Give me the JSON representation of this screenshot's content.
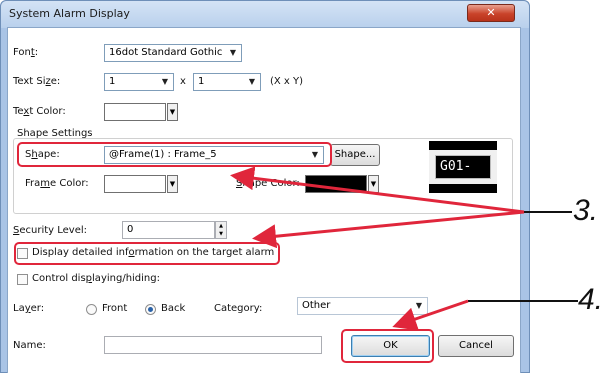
{
  "dialog": {
    "title": "System Alarm Display",
    "close_glyph": "✕"
  },
  "font": {
    "label_pre": "Fon",
    "label_u": "t",
    "label_post": ":",
    "value": "16dot Standard Gothic"
  },
  "text_size": {
    "label_pre": "Text Si",
    "label_u": "z",
    "label_post": "e:",
    "x_value": "1",
    "y_value": "1",
    "times": "x",
    "unit": "(X x Y)"
  },
  "text_color": {
    "label_pre": "Te",
    "label_u": "x",
    "label_post": "t Color:",
    "value": "#ffffff"
  },
  "shape_settings": {
    "group_label": "Shape Settings",
    "shape_label_pre": "S",
    "shape_label_u": "h",
    "shape_label_post": "ape:",
    "shape_value": "@Frame(1) : Frame_5",
    "shape_button": "Shape...",
    "frame_color_label_pre": "Fra",
    "frame_color_label_u": "m",
    "frame_color_label_post": "e Color:",
    "frame_color": "#ffffff",
    "shape_color_label_pre": "",
    "shape_color_label_u": "S",
    "shape_color_label_post": "hape Color:",
    "shape_color": "#000000",
    "preview_text": "G01-"
  },
  "security": {
    "label_pre": "",
    "label_u": "S",
    "label_post": "ecurity Level:",
    "value": "0"
  },
  "options": {
    "detail_pre": "Display detailed inf",
    "detail_u": "o",
    "detail_post": "rmation on the target alarm",
    "detail_checked": false,
    "control_pre": "Control dis",
    "control_u": "p",
    "control_post": "laying/hiding:",
    "control_checked": false
  },
  "layer": {
    "label_pre": "La",
    "label_u": "y",
    "label_post": "er:",
    "front": "Front",
    "back": "Back",
    "selected": "Back"
  },
  "category": {
    "label": "Category:",
    "value": "Other"
  },
  "name": {
    "label": "Name:",
    "value": ""
  },
  "buttons": {
    "ok": "OK",
    "cancel": "Cancel"
  },
  "annotations": {
    "step3": "3.",
    "step4": "4."
  },
  "colors": {
    "highlight": "#e0263b",
    "accent": "#2a62a8"
  }
}
